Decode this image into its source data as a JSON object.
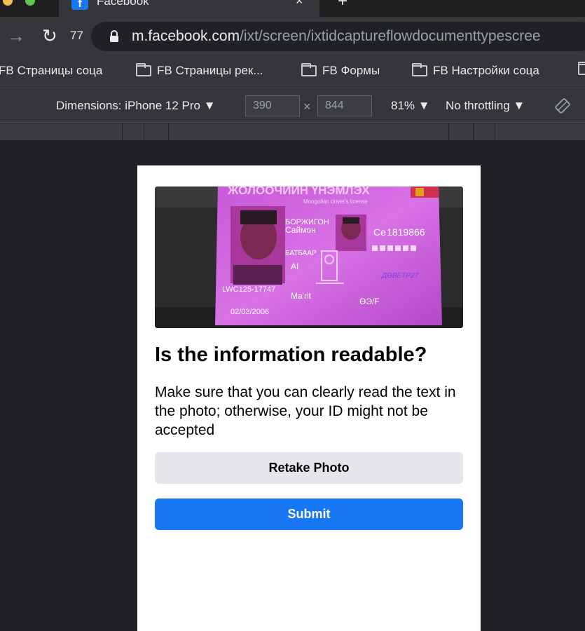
{
  "browser": {
    "tab_title": "Facebook",
    "tab_close_glyph": "×",
    "new_tab_glyph": "+",
    "favicon_letter": "f",
    "reload_count": "77",
    "url_domain": "m.facebook.com",
    "url_path": "/ixt/screen/ixtidcaptureflowdocumenttypescree"
  },
  "bookmarks": [
    {
      "label": "FB Страницы соца"
    },
    {
      "label": "FB Страницы рек..."
    },
    {
      "label": "FB Формы"
    },
    {
      "label": "FB Настройки соца"
    }
  ],
  "devtools": {
    "dimensions_label": "Dimensions: iPhone 12 Pro ▼",
    "width": "390",
    "height": "844",
    "times": "×",
    "zoom": "81% ▼",
    "throttling": "No throttling ▼"
  },
  "id_card": {
    "header": "ЖОЛООЧИЙН ҮНЭМЛЭХ",
    "subheader": "Mongolian driver's license",
    "surname": "БОРЖИГОН",
    "given_name": "Саймон",
    "number": "Ce 1819866",
    "patronymic": "БАТБААР",
    "code1": "AI",
    "license_id": "LWC125-17747",
    "blood": "ӨЭ/F",
    "date": "02/03/2006",
    "stamp": "ДӨВЕТР27",
    "place": "Ma'rit"
  },
  "page": {
    "heading": "Is the information readable?",
    "body": "Make sure that you can clearly read the text in the photo; otherwise, your ID might not be accepted",
    "retake_label": "Retake Photo",
    "submit_label": "Submit"
  },
  "colors": {
    "primary": "#1877f2",
    "secondary_button": "#e4e6eb"
  }
}
